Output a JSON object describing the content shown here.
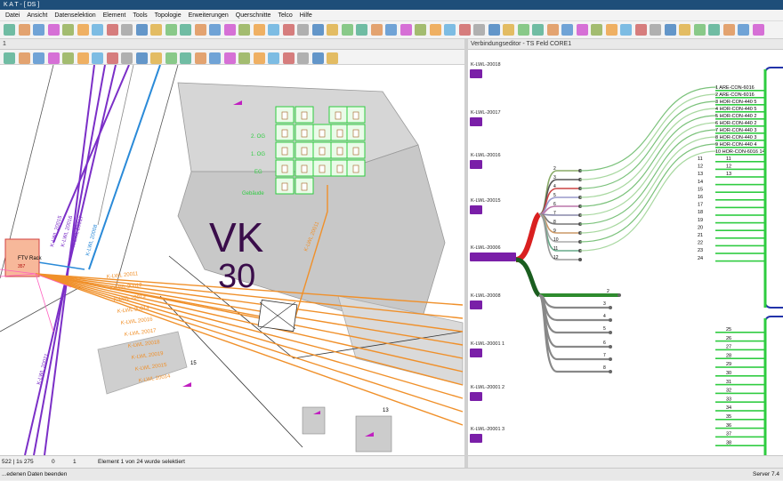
{
  "window": {
    "title": "K A T - [ DS ]"
  },
  "menu": [
    "Datei",
    "Ansicht",
    "Datenselektion",
    "Element",
    "Tools",
    "Topologie",
    "Erweiterungen",
    "Querschnitte",
    "Telco",
    "Hilfe"
  ],
  "left_pane": {
    "title": "1"
  },
  "right_pane": {
    "title": "Verbindungseditor - TS Feld CORE1"
  },
  "map": {
    "vk_label": "VK",
    "vk_number": "30",
    "rack_label": "FTV Rack",
    "rack_sub": "357",
    "cables": [
      "K-LWL 20015",
      "K-LWL 20016",
      "K-LWL 20017",
      "K-LWL 20008",
      "K-LWL 20011",
      "K-LWL 20021"
    ],
    "orange_cables": [
      "K-LWL 20011",
      "K-LWL 20012",
      "K-LWL 20013",
      "K-LWL 20014",
      "K-LWL 20016",
      "K-LWL 20017",
      "K-LWL 20018",
      "K-LWL 20019",
      "K-LWL 20015",
      "K-LWL 20014"
    ],
    "floor_labels": [
      "2. OG",
      "1. OG",
      "EG",
      "Gebäude"
    ],
    "numbers": [
      "15",
      "13"
    ]
  },
  "connections": {
    "cables": [
      "K-LWL-20018",
      "K-LWL-20017",
      "K-LWL-20016",
      "K-LWL-20015",
      "K-LWL-20006",
      "K-LWL-20008",
      "K-LWL-20001 1",
      "K-LWL-20001 2",
      "K-LWL-20001 3"
    ],
    "fibers_red": [
      "2",
      "3",
      "4",
      "5",
      "6",
      "7",
      "8",
      "9",
      "10",
      "11",
      "12"
    ],
    "fibers_gray": [
      "2",
      "3",
      "4",
      "5",
      "6",
      "7",
      "8"
    ],
    "port_labels": [
      "1 ARE-CON-6016",
      "2 ARE-CON-6016",
      "3 HOR-CON-440 5",
      "4 HOR-CON-440 5",
      "5 HOR-CON-440 2",
      "6 HOR-CON-440 2",
      "7 HOR-CON-440 3",
      "8 HOR-CON-440 3",
      "9 HOR-CON-440 4",
      "10 HOR-CON-6016 14"
    ],
    "ports_top": [
      "11",
      "12",
      "13",
      "14",
      "15",
      "16",
      "17",
      "18",
      "19",
      "20",
      "21",
      "22",
      "23",
      "24"
    ],
    "ports_bottom": [
      "25",
      "26",
      "27",
      "28",
      "29",
      "30",
      "31",
      "32",
      "33",
      "34",
      "35",
      "36",
      "37",
      "38"
    ]
  },
  "status": {
    "coord": "522 | 1s 275",
    "field2": "0",
    "field3": "1",
    "message": "Element 1 von 24 wurde selektiert",
    "bottom_left": "...edenen Daten beenden",
    "bottom_right": "Server 7.4"
  },
  "colors": {
    "titlebar": "#1e4e79",
    "purple_cable": "#7b2fc7",
    "orange_cable": "#f0902a",
    "blue_cable": "#2a8ad8",
    "green_port": "#2ecc40",
    "cable_plug": "#7a1fa8"
  }
}
